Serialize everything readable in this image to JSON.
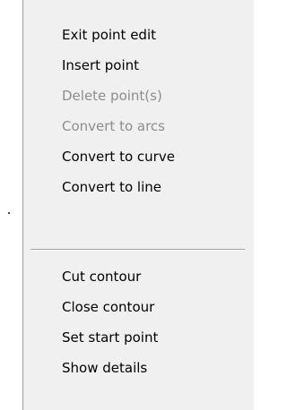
{
  "context_menu": {
    "items": [
      {
        "label": "Exit point edit",
        "enabled": true
      },
      {
        "label": "Insert point",
        "enabled": true
      },
      {
        "label": "Delete point(s)",
        "enabled": false
      },
      {
        "label": "Convert to arcs",
        "enabled": false
      },
      {
        "label": "Convert to curve",
        "enabled": true
      },
      {
        "label": "Convert to line",
        "enabled": true
      },
      {
        "label": "Cut contour",
        "enabled": true
      },
      {
        "label": "Close contour",
        "enabled": true
      },
      {
        "label": "Set start point",
        "enabled": true
      },
      {
        "label": "Show details",
        "enabled": true
      }
    ]
  },
  "colors": {
    "menu_background": "#f0f0f0",
    "enabled_text": "#000000",
    "disabled_text": "#8d8d8d",
    "separator": "#a0a0a0"
  }
}
